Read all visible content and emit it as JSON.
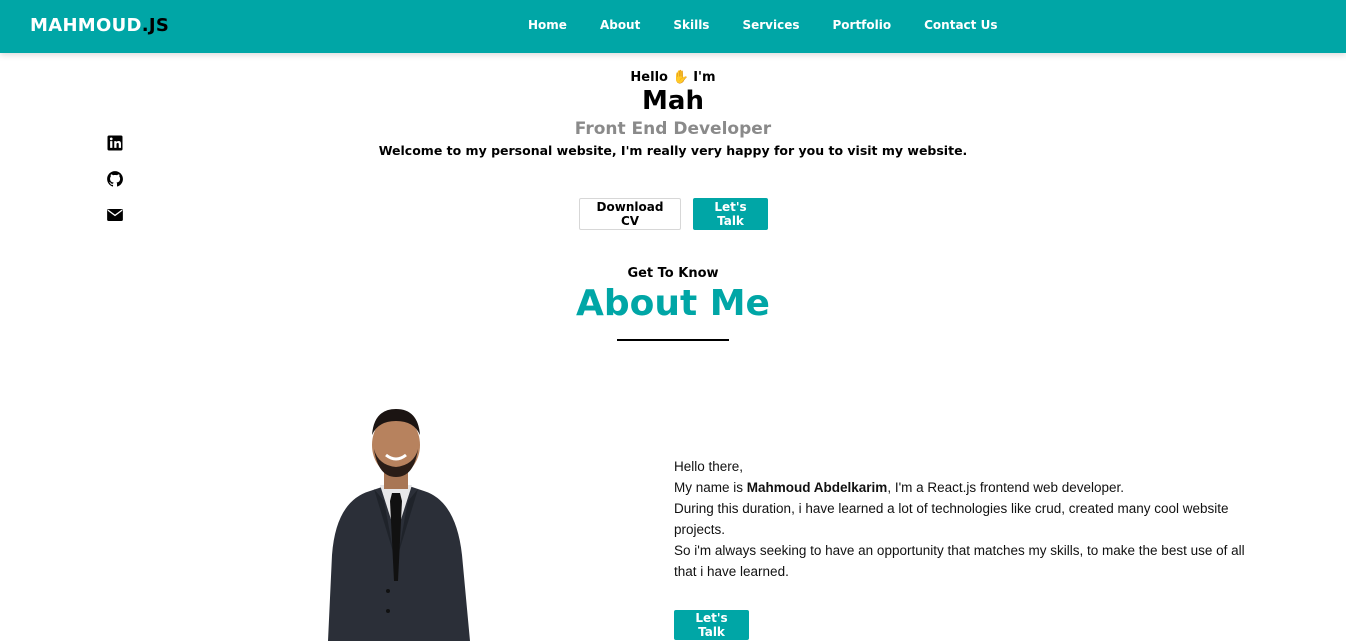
{
  "brand": {
    "name": "MAHMOUD",
    "suffix": ".JS"
  },
  "nav": {
    "items": [
      {
        "label": "Home"
      },
      {
        "label": "About"
      },
      {
        "label": "Skills"
      },
      {
        "label": "Services"
      },
      {
        "label": "Portfolio"
      },
      {
        "label": "Contact Us"
      }
    ]
  },
  "socials": {
    "icons": [
      "linkedin-icon",
      "github-icon",
      "email-icon"
    ]
  },
  "hero": {
    "greeting": "Hello ✋ I'm",
    "name": "Mah",
    "role": "Front End Developer",
    "welcome": "Welcome to my personal website, I'm really very happy for you to visit my website.",
    "download_label": "Download CV",
    "talk_label": "Let's Talk"
  },
  "about": {
    "subtitle": "Get To Know",
    "title": "About Me",
    "line1": "Hello there,",
    "line2_prefix": "My name is ",
    "line2_name": "Mahmoud Abdelkarim",
    "line2_suffix": ", I'm a React.js frontend web developer.",
    "line3": "During this duration, i have learned a lot of technologies like crud, created many cool website projects.",
    "line4": "So i'm always seeking to have an opportunity that matches my skills, to make the best use of all that i have learned.",
    "talk_label": "Let's Talk"
  },
  "colors": {
    "accent": "#00a6a6",
    "muted": "#8a8a8a"
  }
}
